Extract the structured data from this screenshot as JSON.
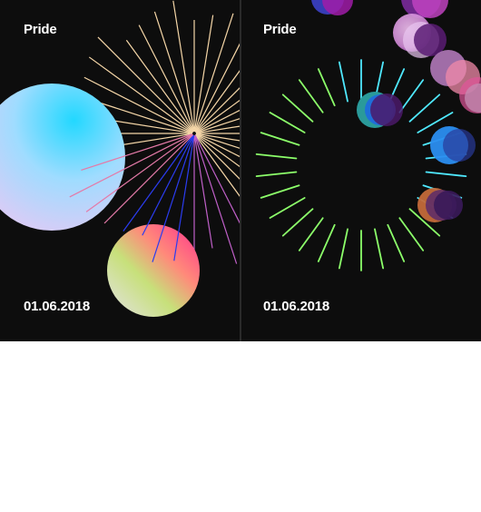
{
  "posters": [
    {
      "title": "Pride",
      "date": "01.06.2018"
    },
    {
      "title": "Pride",
      "date": "01.06.2018"
    }
  ],
  "colors": {
    "background": "#0d0d0d",
    "text": "#ffffff",
    "burst_warm": "#f6d7a8",
    "burst_pink": "#e47aa8",
    "burst_blue": "#2b3cf0",
    "ring_green": "#8cff6a",
    "ring_cyan": "#4fe9ff"
  }
}
